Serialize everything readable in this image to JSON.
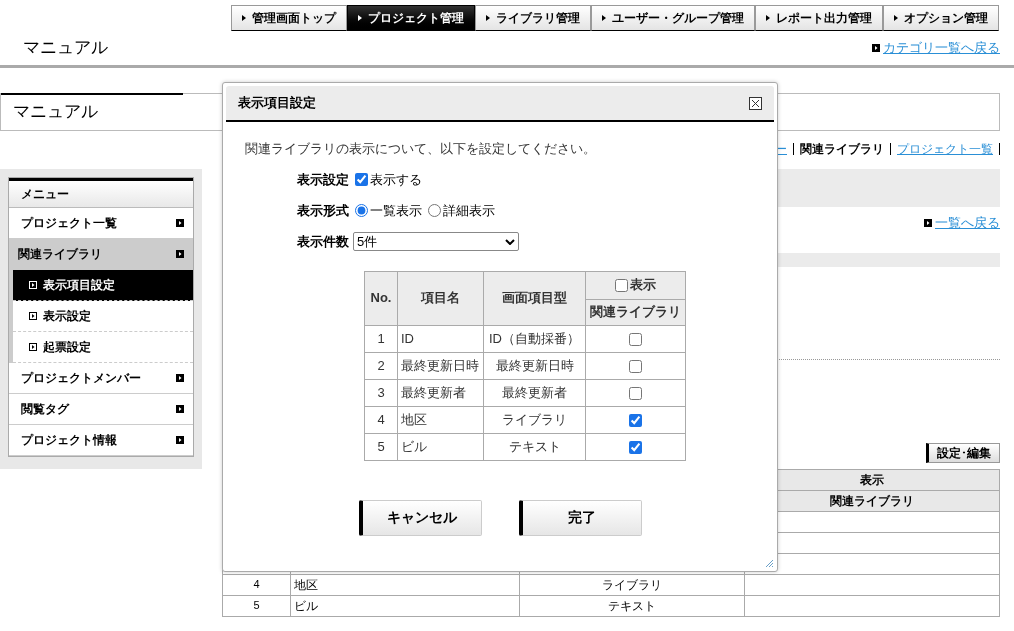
{
  "top_nav": [
    {
      "label": "管理画面トップ",
      "selected": false
    },
    {
      "label": "プロジェクト管理",
      "selected": true
    },
    {
      "label": "ライブラリ管理",
      "selected": false
    },
    {
      "label": "ユーザー・グループ管理",
      "selected": false
    },
    {
      "label": "レポート出力管理",
      "selected": false
    },
    {
      "label": "オプション管理",
      "selected": false
    }
  ],
  "header": {
    "title": "マニュアル",
    "back_link": "カテゴリ一覧へ戻る"
  },
  "panel_title": "マニュアル",
  "sidebar": {
    "heading": "メニュー",
    "items": [
      {
        "label": "プロジェクト一覧",
        "selected": false
      },
      {
        "label": "関連ライブラリ",
        "selected": true,
        "children": [
          {
            "label": "表示項目設定",
            "selected": true
          },
          {
            "label": "表示設定",
            "selected": false
          },
          {
            "label": "起票設定",
            "selected": false
          }
        ]
      },
      {
        "label": "プロジェクトメンバー",
        "selected": false
      },
      {
        "label": "閲覧タグ",
        "selected": false
      },
      {
        "label": "プロジェクト情報",
        "selected": false
      }
    ]
  },
  "breadcrumb": [
    {
      "label": "ー",
      "current": false
    },
    {
      "label": "関連ライブラリ",
      "current": true
    },
    {
      "label": "プロジェクト一覧",
      "current": false
    }
  ],
  "list_back_link": "一覧へ戻る",
  "edit_button": "設定･編集",
  "background_table": {
    "header_top": "表示",
    "header_bottom": "関連ライブラリ",
    "rows": [
      {
        "no": "4",
        "name": "地区",
        "type": "ライブラリ"
      },
      {
        "no": "5",
        "name": "ビル",
        "type": "テキスト"
      }
    ]
  },
  "dialog": {
    "title": "表示項目設定",
    "description": "関連ライブラリの表示について、以下を設定してください。",
    "display_setting": {
      "label": "表示設定",
      "option": "表示する",
      "checked": true
    },
    "display_format": {
      "label": "表示形式",
      "options": [
        {
          "label": "一覧表示",
          "selected": true
        },
        {
          "label": "詳細表示",
          "selected": false
        }
      ]
    },
    "display_count": {
      "label": "表示件数",
      "value": "5件"
    },
    "table": {
      "columns": [
        "No.",
        "項目名",
        "画面項目型"
      ],
      "show_header": {
        "label": "表示",
        "checked": false
      },
      "sub_header": "関連ライブラリ",
      "rows": [
        {
          "no": "1",
          "name": "ID",
          "type": "ID（自動採番）",
          "checked": false
        },
        {
          "no": "2",
          "name": "最終更新日時",
          "type": "最終更新日時",
          "checked": false
        },
        {
          "no": "3",
          "name": "最終更新者",
          "type": "最終更新者",
          "checked": false
        },
        {
          "no": "4",
          "name": "地区",
          "type": "ライブラリ",
          "checked": true
        },
        {
          "no": "5",
          "name": "ビル",
          "type": "テキスト",
          "checked": true
        }
      ]
    },
    "buttons": [
      "キャンセル",
      "完了"
    ]
  }
}
